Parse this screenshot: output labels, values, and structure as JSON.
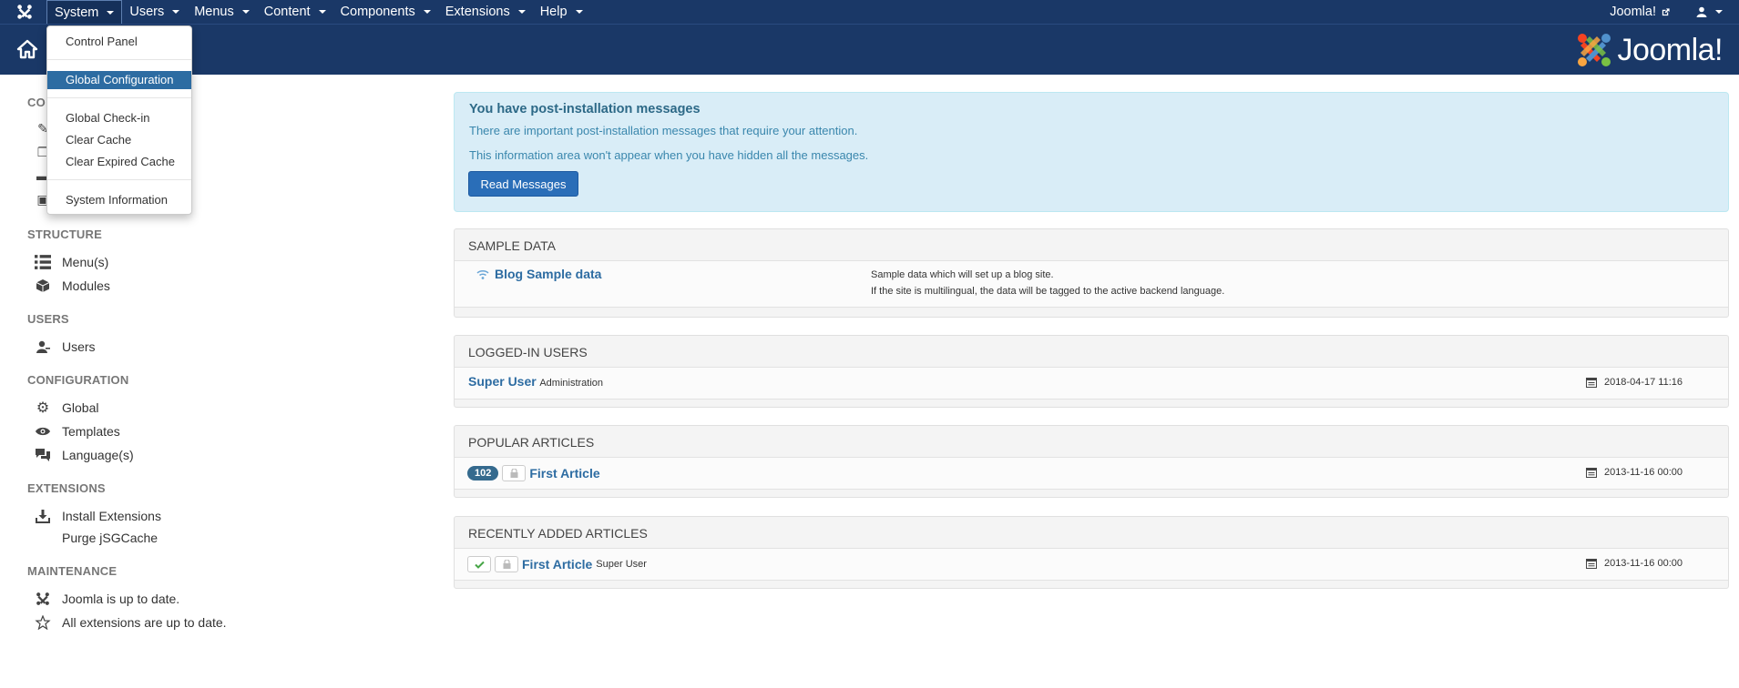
{
  "navbar": {
    "menus": [
      {
        "label": "System"
      },
      {
        "label": "Users"
      },
      {
        "label": "Menus"
      },
      {
        "label": "Content"
      },
      {
        "label": "Components"
      },
      {
        "label": "Extensions"
      },
      {
        "label": "Help"
      }
    ],
    "site_label": "Joomla!"
  },
  "brand": {
    "name": "Joomla!"
  },
  "system_menu": {
    "items": [
      "Control Panel",
      "Global Configuration",
      "Global Check-in",
      "Clear Cache",
      "Clear Expired Cache",
      "System Information"
    ],
    "highlighted": "Global Configuration"
  },
  "sidebar": {
    "sections": {
      "content": "CO",
      "structure": "STRUCTURE",
      "users": "USERS",
      "configuration": "CONFIGURATION",
      "extensions": "EXTENSIONS",
      "maintenance": "MAINTENANCE"
    },
    "items": {
      "menus": "Menu(s)",
      "modules": "Modules",
      "users": "Users",
      "global": "Global",
      "templates": "Templates",
      "languages": "Language(s)",
      "install_extensions": "Install Extensions",
      "purge_cache": "Purge jSGCache",
      "joomla_status": "Joomla is up to date.",
      "extensions_status": "All extensions are up to date."
    }
  },
  "alert": {
    "title": "You have post-installation messages",
    "line1": "There are important post-installation messages that require your attention.",
    "line2": "This information area won't appear when you have hidden all the messages.",
    "button": "Read Messages"
  },
  "sample_data": {
    "heading": "SAMPLE DATA",
    "link": "Blog Sample data",
    "desc1": "Sample data which will set up a blog site.",
    "desc2": "If the site is multilingual, the data will be tagged to the active backend language."
  },
  "logged_in": {
    "heading": "LOGGED-IN USERS",
    "user": "Super User",
    "role": "Administration",
    "date": "2018-04-17 11:16"
  },
  "popular": {
    "heading": "POPULAR ARTICLES",
    "hits": "102",
    "title": "First Article",
    "date": "2013-11-16 00:00"
  },
  "recent": {
    "heading": "RECENTLY ADDED ARTICLES",
    "title": "First Article",
    "author": "Super User",
    "date": "2013-11-16 00:00"
  },
  "colors": {
    "navbar": "#1a3867",
    "highlight": "#2d6ca2",
    "alert_bg": "#d9edf7",
    "button": "#2a6eb8"
  }
}
